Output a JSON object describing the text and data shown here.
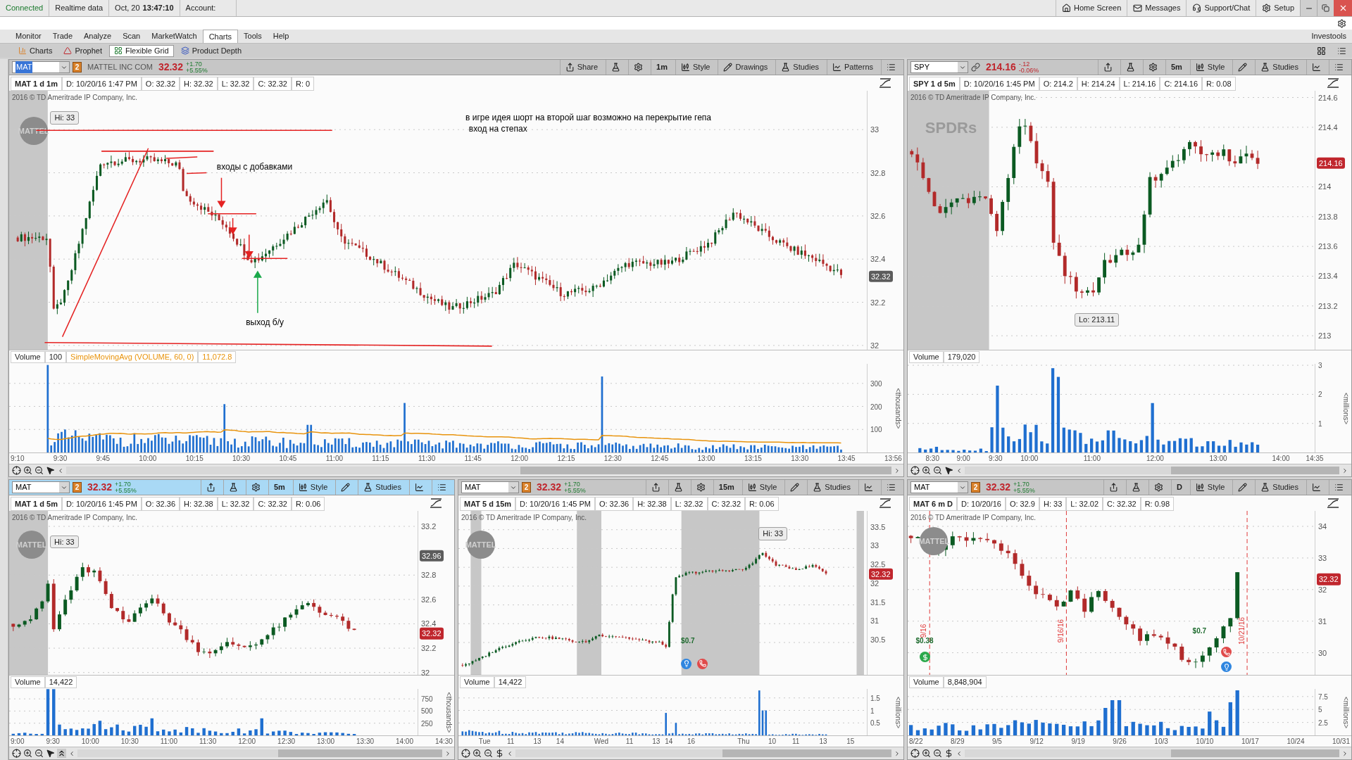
{
  "status_bar": {
    "connection": "Connected",
    "feed": "Realtime data",
    "date": "Oct, 20",
    "time": "13:47:10",
    "account": "Account:",
    "links": [
      {
        "kind": "home",
        "label": "Home Screen"
      },
      {
        "kind": "messages",
        "label": "Messages"
      },
      {
        "kind": "support",
        "label": "Support/Chat"
      },
      {
        "kind": "setup",
        "label": "Setup"
      }
    ]
  },
  "menu": {
    "tabs": [
      {
        "label": "Monitor",
        "selected": false
      },
      {
        "label": "Trade",
        "selected": false
      },
      {
        "label": "Analyze",
        "selected": false
      },
      {
        "label": "Scan",
        "selected": false
      },
      {
        "label": "MarketWatch",
        "selected": false
      },
      {
        "label": "Charts",
        "selected": true
      },
      {
        "label": "Tools",
        "selected": false
      },
      {
        "label": "Help",
        "selected": false
      }
    ],
    "brand": "Investools"
  },
  "subtabs": [
    {
      "kind": "charts",
      "label": "Charts",
      "selected": false
    },
    {
      "kind": "prophet",
      "label": "Prophet",
      "selected": false
    },
    {
      "kind": "grid",
      "label": "Flexible Grid",
      "selected": true
    },
    {
      "kind": "depth",
      "label": "Product Depth",
      "selected": false
    }
  ],
  "panels": [
    {
      "active": false,
      "symbol": {
        "text": "MAT",
        "text_selected": true
      },
      "link": {
        "kind": "number",
        "text": "2"
      },
      "company": "MATTEL INC COM",
      "price": "32.32",
      "change": "+1.70",
      "change_pct": "+5.55%",
      "change_positive": true,
      "tools": [
        {
          "kind": "share",
          "label": "Share"
        },
        {
          "kind": "flask"
        },
        {
          "kind": "gear"
        },
        {
          "kind": "interval",
          "label": "1m"
        },
        {
          "kind": "style",
          "label": "Style"
        },
        {
          "kind": "drawings",
          "label": "Drawings"
        },
        {
          "kind": "studies",
          "label": "Studies"
        },
        {
          "kind": "patterns",
          "label": "Patterns"
        },
        {
          "kind": "menu"
        }
      ],
      "info": [
        "MAT 1 d 1m",
        "D: 10/20/16 1:47 PM",
        "O: 32.32",
        "H: 32.32",
        "L: 32.32",
        "C: 32.32",
        "R: 0"
      ],
      "copyright": "2016 © TD Ameritrade IP Company, Inc.",
      "logo": "MATTEL",
      "price_ticks": [
        "33",
        "32.8",
        "32.6",
        "32.4",
        "32.2",
        "32"
      ],
      "price_badges": [
        {
          "text": "32.32",
          "kind": "marker"
        }
      ],
      "callouts": [
        {
          "text": "Hi: 33"
        }
      ],
      "notes": [
        "в игре  идея шорт на второй шаг возможно на перекрытие гепа",
        "вход на степах",
        "входы с добавками",
        "выход б/у"
      ],
      "volume": {
        "label": "Volume",
        "value": "100",
        "study": {
          "name": "SimpleMovingAvg (VOLUME, 60, 0)",
          "value": "11,072.8"
        },
        "ticks": [
          "300",
          "200",
          "100"
        ],
        "unit": "<thousands>"
      },
      "time_ticks": [
        "9:10",
        "9:30",
        "9:45",
        "10:00",
        "10:15",
        "10:30",
        "10:45",
        "11:00",
        "11:15",
        "11:30",
        "11:45",
        "12:00",
        "12:15",
        "12:30",
        "12:45",
        "13:00",
        "13:15",
        "13:30",
        "13:45",
        "13:56"
      ]
    },
    {
      "active": false,
      "symbol": {
        "text": "SPY",
        "text_selected": false
      },
      "link": {
        "kind": "chain"
      },
      "price": "214.16",
      "change": "-.12",
      "change_pct": "-0.06%",
      "change_positive": false,
      "tools": [
        {
          "kind": "share"
        },
        {
          "kind": "flask"
        },
        {
          "kind": "gear"
        },
        {
          "kind": "interval",
          "label": "5m"
        },
        {
          "kind": "style",
          "label": "Style"
        },
        {
          "kind": "drawings"
        },
        {
          "kind": "studies",
          "label": "Studies"
        },
        {
          "kind": "patterns"
        },
        {
          "kind": "menu"
        }
      ],
      "info": [
        "SPY 1 d 5m",
        "D: 10/20/16 1:45 PM",
        "O: 214.2",
        "H: 214.24",
        "L: 214.16",
        "C: 214.16",
        "R: 0.08"
      ],
      "copyright": "2016 © TD Ameritrade IP Company, Inc.",
      "logo": "SPDRs",
      "price_ticks": [
        "214.6",
        "214.4",
        "214",
        "213.8",
        "213.6",
        "213.4",
        "213.2",
        "213"
      ],
      "price_badges": [
        {
          "text": "214.16",
          "kind": "last"
        }
      ],
      "callouts": [
        {
          "text": "Lo: 213.11"
        }
      ],
      "volume": {
        "label": "Volume",
        "value": "179,020",
        "ticks": [
          "3",
          "2",
          "1"
        ],
        "unit": "<millions>"
      },
      "time_ticks": [
        "8:30",
        "9:00",
        "9:30",
        "10:00",
        "11:00",
        "12:00",
        "13:00",
        "14:00",
        "14:35"
      ]
    },
    {
      "active": true,
      "symbol": {
        "text": "MAT",
        "text_selected": false
      },
      "link": {
        "kind": "number",
        "text": "2"
      },
      "price": "32.32",
      "change": "+1.70",
      "change_pct": "+5.55%",
      "change_positive": true,
      "tools": [
        {
          "kind": "share"
        },
        {
          "kind": "flask"
        },
        {
          "kind": "gear"
        },
        {
          "kind": "interval",
          "label": "5m"
        },
        {
          "kind": "style",
          "label": "Style"
        },
        {
          "kind": "drawings"
        },
        {
          "kind": "studies",
          "label": "Studies"
        },
        {
          "kind": "patterns"
        },
        {
          "kind": "menu"
        }
      ],
      "info": [
        "MAT 1 d 5m",
        "D: 10/20/16 1:45 PM",
        "O: 32.36",
        "H: 32.38",
        "L: 32.32",
        "C: 32.32",
        "R: 0.06"
      ],
      "copyright": "2016 © TD Ameritrade IP Company, Inc.",
      "logo": "MATTEL",
      "price_ticks": [
        "33.2",
        "32.8",
        "32.6",
        "32.4",
        "32.2",
        "32"
      ],
      "price_badges": [
        {
          "text": "32.96",
          "kind": "marker"
        },
        {
          "text": "32.32",
          "kind": "last"
        }
      ],
      "callouts": [
        {
          "text": "Hi: 33"
        }
      ],
      "volume": {
        "label": "Volume",
        "value": "14,422",
        "ticks": [
          "750",
          "500",
          "250"
        ],
        "unit": "<thousands>"
      },
      "time_ticks": [
        "9:00",
        "9:30",
        "10:00",
        "10:30",
        "11:00",
        "11:30",
        "12:00",
        "12:30",
        "13:00",
        "13:30",
        "14:00",
        "14:30"
      ]
    },
    {
      "active": false,
      "symbol": {
        "text": "MAT",
        "text_selected": false
      },
      "link": {
        "kind": "number",
        "text": "2"
      },
      "price": "32.32",
      "change": "+1.70",
      "change_pct": "+5.55%",
      "change_positive": true,
      "tools": [
        {
          "kind": "share"
        },
        {
          "kind": "flask"
        },
        {
          "kind": "gear"
        },
        {
          "kind": "interval",
          "label": "15m"
        },
        {
          "kind": "style",
          "label": "Style"
        },
        {
          "kind": "drawings"
        },
        {
          "kind": "studies",
          "label": "Studies"
        },
        {
          "kind": "patterns"
        },
        {
          "kind": "menu"
        }
      ],
      "info": [
        "MAT 5 d 15m",
        "D: 10/20/16 1:45 PM",
        "O: 32.36",
        "H: 32.38",
        "L: 32.32",
        "C: 32.32",
        "R: 0.06"
      ],
      "copyright": "2016 © TD Ameritrade IP Company, Inc.",
      "logo": "MATTEL",
      "price_ticks": [
        "33.5",
        "33",
        "32.5",
        "32",
        "31.5",
        "31",
        "30.5"
      ],
      "price_badges": [
        {
          "text": "32.32",
          "kind": "last"
        }
      ],
      "callouts": [
        {
          "text": "Hi: 33"
        }
      ],
      "events": [
        {
          "kind": "dividend",
          "label": "$0.7"
        },
        {
          "kind": "earnings"
        },
        {
          "kind": "conference"
        }
      ],
      "volume": {
        "label": "Volume",
        "value": "14,422",
        "ticks": [
          "1.5",
          "1",
          "0.5"
        ],
        "unit": "<millions>"
      },
      "time_ticks": [
        "Tue",
        "11",
        "13",
        "14",
        "Wed",
        "11",
        "13",
        "14",
        "16",
        "Thu",
        "10",
        "11",
        "13",
        "15"
      ]
    },
    {
      "active": false,
      "symbol": {
        "text": "MAT",
        "text_selected": false
      },
      "link": {
        "kind": "number",
        "text": "2"
      },
      "price": "32.32",
      "change": "+1.70",
      "change_pct": "+5.55%",
      "change_positive": true,
      "tools": [
        {
          "kind": "share"
        },
        {
          "kind": "flask"
        },
        {
          "kind": "gear"
        },
        {
          "kind": "interval",
          "label": "D"
        },
        {
          "kind": "style",
          "label": "Style"
        },
        {
          "kind": "drawings"
        },
        {
          "kind": "studies",
          "label": "Studies"
        },
        {
          "kind": "patterns"
        },
        {
          "kind": "menu"
        }
      ],
      "info": [
        "MAT 6 m D",
        "D: 10/20/16",
        "O: 32.9",
        "H: 33",
        "L: 32.02",
        "C: 32.32",
        "R: 0.98"
      ],
      "copyright": "2016 © TD Ameritrade IP Company, Inc.",
      "logo": "MATTEL",
      "price_ticks": [
        "34",
        "33",
        "32",
        "31",
        "30"
      ],
      "price_badges": [
        {
          "text": "32.32",
          "kind": "last"
        }
      ],
      "events": [
        {
          "kind": "dividend",
          "label": "$0.38"
        },
        {
          "kind": "dividend_icon"
        },
        {
          "kind": "dividend",
          "label": "$0.7"
        },
        {
          "kind": "conference"
        },
        {
          "kind": "earnings"
        }
      ],
      "event_lines": [
        {
          "label": "9/16"
        },
        {
          "label": "9/16/16"
        },
        {
          "label": "10/21/16"
        }
      ],
      "volume": {
        "label": "Volume",
        "value": "8,848,904",
        "ticks": [
          "7.5",
          "5",
          "2.5"
        ],
        "unit": "<millions>"
      },
      "time_ticks": [
        "8/22",
        "8/29",
        "9/5",
        "9/12",
        "9/19",
        "9/26",
        "10/3",
        "10/10",
        "10/17",
        "10/24",
        "10/31"
      ]
    }
  ]
}
